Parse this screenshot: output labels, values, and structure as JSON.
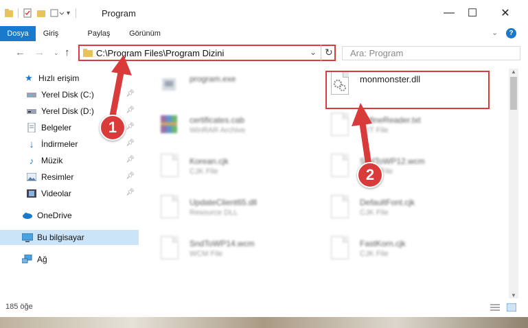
{
  "window": {
    "title": "Program"
  },
  "ribbon": {
    "tabs": [
      "Dosya",
      "Giriş",
      "Paylaş",
      "Görünüm"
    ]
  },
  "address": {
    "path": "C:\\Program Files\\Program Dizini"
  },
  "search": {
    "placeholder": "Ara: Program"
  },
  "nav": {
    "quick_access": "Hızlı erişim",
    "items": [
      {
        "label": "Yerel Disk (C:)",
        "icon": "drive-icon"
      },
      {
        "label": "Yerel Disk (D:)",
        "icon": "drive-icon"
      },
      {
        "label": "Belgeler",
        "icon": "documents-icon"
      },
      {
        "label": "İndirmeler",
        "icon": "download-icon"
      },
      {
        "label": "Müzik",
        "icon": "music-icon"
      },
      {
        "label": "Resimler",
        "icon": "pictures-icon"
      },
      {
        "label": "Videolar",
        "icon": "videos-icon"
      }
    ],
    "onedrive": "OneDrive",
    "this_pc": "Bu bilgisayar",
    "network": "Ağ"
  },
  "files": [
    {
      "name": "program.exe",
      "sub": ""
    },
    {
      "name": "monmonster.dll",
      "sub": ""
    },
    {
      "name": "certificates.cab",
      "sub": "WinRAR Archive"
    },
    {
      "name": "ApfineReader.txt",
      "sub": "TXT File"
    },
    {
      "name": "Korean.cjk",
      "sub": "CJK File"
    },
    {
      "name": "SndToWP12.wcm",
      "sub": "WCM File"
    },
    {
      "name": "UpdateClient65.dll",
      "sub": "Resource DLL"
    },
    {
      "name": "DefaultFont.cjk",
      "sub": "CJK File"
    },
    {
      "name": "SndToWP14.wcm",
      "sub": "WCM File"
    },
    {
      "name": "FastKorn.cjk",
      "sub": "CJK File"
    }
  ],
  "status": {
    "count": "185 öğe"
  },
  "annotations": {
    "step1": "1",
    "step2": "2"
  },
  "colors": {
    "accent": "#1979ca",
    "highlight": "#d93b3b",
    "selected": "#cce4f7"
  }
}
